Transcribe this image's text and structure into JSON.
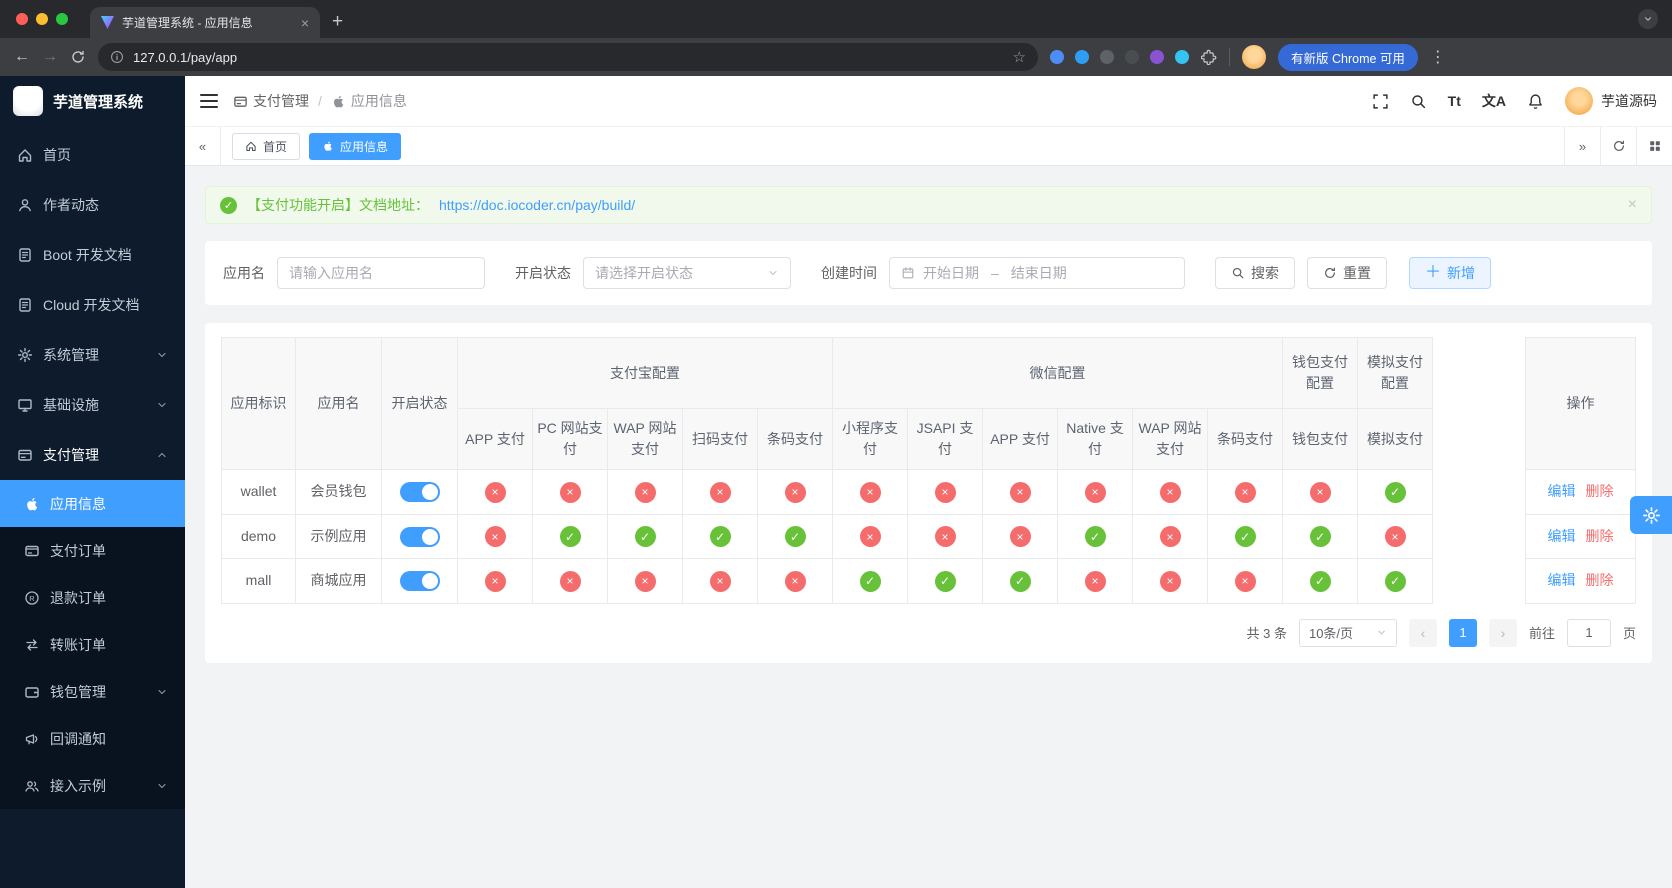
{
  "browser": {
    "tab_title": "芋道管理系统 - 应用信息",
    "url": "127.0.0.1/pay/app",
    "update_chip": "有新版 Chrome 可用",
    "extensions": [
      {
        "name": "extension-icon-grid",
        "color": "#4c8df6"
      },
      {
        "name": "extension-icon-drop",
        "color": "#2f9df4"
      },
      {
        "name": "extension-icon-dark-ring",
        "color": "#5f6368"
      },
      {
        "name": "extension-icon-dark-circle",
        "color": "#494d51"
      },
      {
        "name": "extension-icon-purple",
        "color": "#8a53d2"
      },
      {
        "name": "extension-icon-cyan",
        "color": "#35c3f1"
      }
    ]
  },
  "sidebar": {
    "logo_title": "芋道管理系统",
    "items": [
      {
        "key": "home",
        "label": "首页",
        "icon": "home"
      },
      {
        "key": "author-news",
        "label": "作者动态",
        "icon": "user"
      },
      {
        "key": "boot-docs",
        "label": "Boot 开发文档",
        "icon": "doc"
      },
      {
        "key": "cloud-docs",
        "label": "Cloud 开发文档",
        "icon": "doc"
      },
      {
        "key": "system",
        "label": "系统管理",
        "icon": "gear",
        "chevron": "down"
      },
      {
        "key": "infra",
        "label": "基础设施",
        "icon": "monitor",
        "chevron": "down"
      },
      {
        "key": "pay",
        "label": "支付管理",
        "icon": "pay",
        "chevron": "up",
        "children": [
          {
            "key": "app-info",
            "label": "应用信息",
            "icon": "apple",
            "active": true
          },
          {
            "key": "pay-order",
            "label": "支付订单",
            "icon": "card"
          },
          {
            "key": "refund-order",
            "label": "退款订单",
            "icon": "refund"
          },
          {
            "key": "transfer-order",
            "label": "转账订单",
            "icon": "transfer"
          },
          {
            "key": "wallet-mgmt",
            "label": "钱包管理",
            "icon": "wallet",
            "chevron": "down"
          },
          {
            "key": "callback-notify",
            "label": "回调通知",
            "icon": "notify"
          },
          {
            "key": "examples",
            "label": "接入示例",
            "icon": "users",
            "chevron": "down"
          }
        ]
      }
    ]
  },
  "header": {
    "breadcrumb": [
      {
        "label": "支付管理"
      },
      {
        "label": "应用信息"
      }
    ],
    "user_name": "芋道源码"
  },
  "tagbar": {
    "tabs": [
      {
        "label": "首页",
        "active": false
      },
      {
        "label": "应用信息",
        "active": true
      }
    ]
  },
  "alert": {
    "text": "【支付功能开启】文档地址：",
    "link": "https://doc.iocoder.cn/pay/build/"
  },
  "filters": {
    "app_name_label": "应用名",
    "app_name_placeholder": "请输入应用名",
    "status_label": "开启状态",
    "status_placeholder": "请选择开启状态",
    "date_label": "创建时间",
    "date_start_placeholder": "开始日期",
    "date_separator": "–",
    "date_end_placeholder": "结束日期",
    "search_button": "搜索",
    "reset_button": "重置",
    "add_button": "新增"
  },
  "table": {
    "simple_columns": [
      "应用标识",
      "应用名",
      "开启状态"
    ],
    "groups": [
      {
        "label": "支付宝配置",
        "columns": [
          "APP 支付",
          "PC 网站支付",
          "WAP 网站支付",
          "扫码支付",
          "条码支付"
        ]
      },
      {
        "label": "微信配置",
        "columns": [
          "小程序支付",
          "JSAPI 支付",
          "APP 支付",
          "Native 支付",
          "WAP 网站支付",
          "条码支付"
        ]
      },
      {
        "label": "钱包支付配置",
        "columns": [
          "钱包支付"
        ]
      },
      {
        "label": "模拟支付配置",
        "columns": [
          "模拟支付"
        ]
      }
    ],
    "action_column": "操作",
    "row_actions": [
      "编辑",
      "删除"
    ],
    "rows": [
      {
        "app_id": "wallet",
        "app_name": "会员钱包",
        "enabled": true,
        "payments": [
          false,
          false,
          false,
          false,
          false,
          false,
          false,
          false,
          false,
          false,
          false,
          false,
          true
        ]
      },
      {
        "app_id": "demo",
        "app_name": "示例应用",
        "enabled": true,
        "payments": [
          false,
          true,
          true,
          true,
          true,
          false,
          false,
          false,
          true,
          false,
          true,
          true,
          false
        ]
      },
      {
        "app_id": "mall",
        "app_name": "商城应用",
        "enabled": true,
        "payments": [
          false,
          false,
          false,
          false,
          false,
          true,
          true,
          true,
          false,
          false,
          false,
          true,
          true
        ]
      }
    ]
  },
  "pagination": {
    "total_text": "共 3 条",
    "page_size_text": "10条/页",
    "current_page": "1",
    "goto_prefix": "前往",
    "goto_value": "1",
    "goto_suffix": "页"
  },
  "colors": {
    "accent": "#409eff",
    "success": "#67c23a",
    "danger": "#f56c6c",
    "sidebar_bg": "#0d1b2d"
  }
}
